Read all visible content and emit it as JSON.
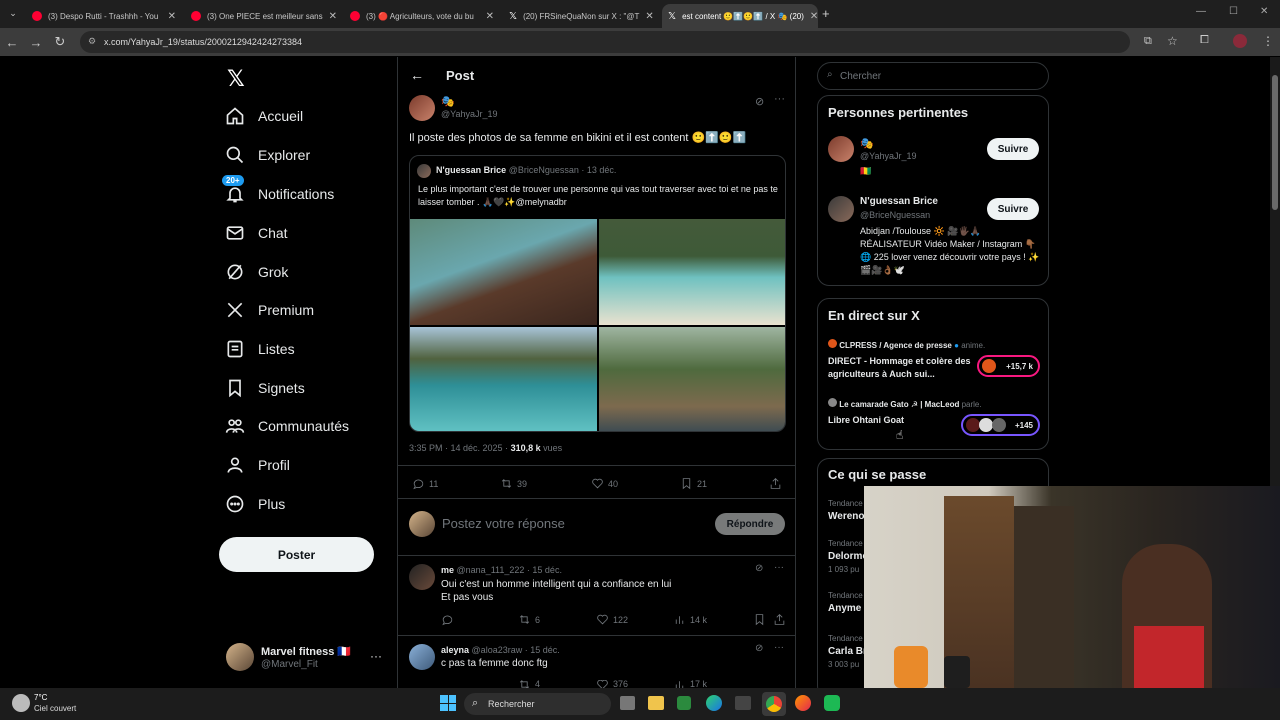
{
  "browser": {
    "tabs": [
      {
        "title": "(3) Despo Rutti - Trashhh - You",
        "favicon_color": "#ff0033"
      },
      {
        "title": "(3) One PIECE est meilleur sans",
        "favicon_color": "#ff0033"
      },
      {
        "title": "(3) 🔴 Agriculteurs, vote du bu",
        "favicon_color": "#ff0033"
      },
      {
        "title": "(20) FRSineQuaNon sur X : \"@T",
        "favicon_color": "#ffffff"
      },
      {
        "title": "est content 🙂⬆️🙂⬆️ / X 🎭 (20)",
        "favicon_color": "#ffffff"
      }
    ],
    "url": "x.com/YahyaJr_19/status/2000212942424273384"
  },
  "sidebar": {
    "items": [
      {
        "label": "Accueil",
        "icon": "home-icon"
      },
      {
        "label": "Explorer",
        "icon": "search-icon"
      },
      {
        "label": "Notifications",
        "icon": "bell-icon",
        "badge": "20+"
      },
      {
        "label": "Chat",
        "icon": "mail-icon"
      },
      {
        "label": "Grok",
        "icon": "grok-icon"
      },
      {
        "label": "Premium",
        "icon": "x-logo-icon"
      },
      {
        "label": "Listes",
        "icon": "list-icon"
      },
      {
        "label": "Signets",
        "icon": "bookmark-icon"
      },
      {
        "label": "Communautés",
        "icon": "people-icon"
      },
      {
        "label": "Profil",
        "icon": "user-icon"
      },
      {
        "label": "Plus",
        "icon": "more-circle-icon"
      }
    ],
    "post_button": "Poster",
    "account": {
      "name": "Marvel fitness 🇫🇷",
      "handle": "@Marvel_Fit"
    }
  },
  "post": {
    "header_title": "Post",
    "author_name": "🎭",
    "author_handle": "@YahyaJr_19",
    "text": "Il poste des photos de sa femme en bikini et il est content 🙂⬆️🙂⬆️",
    "quote": {
      "name": "N'guessan Brice",
      "handle": "@BriceNguessan",
      "date": "· 13 déc.",
      "text": "Le plus important c'est de trouver une personne qui vas tout traverser avec toi et ne pas te laisser tomber . 🙏🏿🖤✨@melynadbr"
    },
    "meta_time": "3:35 PM · 14 déc. 2025 · ",
    "views": "310,8 k",
    "views_label": "vues",
    "stats": {
      "replies": "11",
      "reposts": "39",
      "likes": "40",
      "bookmarks": "21"
    },
    "reply_placeholder": "Postez votre réponse",
    "reply_button": "Répondre"
  },
  "replies": [
    {
      "name": "me",
      "handle": "@nana_111_222",
      "date": "· 15 déc.",
      "text1": "Oui c'est un homme intelligent qui a confiance en lui",
      "text2": "Et pas vous",
      "reposts": "6",
      "likes": "122",
      "views": "14 k"
    },
    {
      "name": "aleyna",
      "handle": "@aloa23raw",
      "date": "· 15 déc.",
      "text1": "c pas ta femme donc ftg",
      "text2": "",
      "reposts": "4",
      "likes": "376",
      "views": "17 k"
    }
  ],
  "right": {
    "search_placeholder": "Chercher",
    "relevant_title": "Personnes pertinentes",
    "people": [
      {
        "name": "🎭",
        "handle": "@YahyaJr_19",
        "bio": "🇬🇳",
        "follow": "Suivre"
      },
      {
        "name": "N'guessan Brice",
        "handle": "@BriceNguessan",
        "bio": "Abidjan /Toulouse 🔆 🎥🖐🏿🙏🏿 RÉALISATEUR Vidéo Maker / Instagram 👇🏾 🌐 225 lover venez découvrir votre pays ! ✨🎬🎥👌🏾🕊️",
        "follow": "Suivre"
      }
    ],
    "live_title": "En direct sur X",
    "live": [
      {
        "host": "CLPRESS / Agence de presse",
        "role": "anime.",
        "title": "DIRECT - Hommage et colère des agriculteurs à Auch sui...",
        "count": "+15,7 k"
      },
      {
        "host": "Le camarade Gato ☭ | MacLeod",
        "role": "parle.",
        "title": "Libre Ohtani Goat",
        "count": "+145"
      }
    ],
    "trends_title": "Ce qui se passe",
    "trends": [
      {
        "cat": "Tendance",
        "name": "Wereno",
        "count": ""
      },
      {
        "cat": "Tendance",
        "name": "Delorme",
        "count": "1 093 pu"
      },
      {
        "cat": "Tendance",
        "name": "Anyme",
        "count": ""
      },
      {
        "cat": "Tendance",
        "name": "Carla Br",
        "count": "3 003 pu"
      }
    ]
  },
  "taskbar": {
    "weather_temp": "7°C",
    "weather_desc": "Ciel couvert",
    "search": "Rechercher"
  }
}
